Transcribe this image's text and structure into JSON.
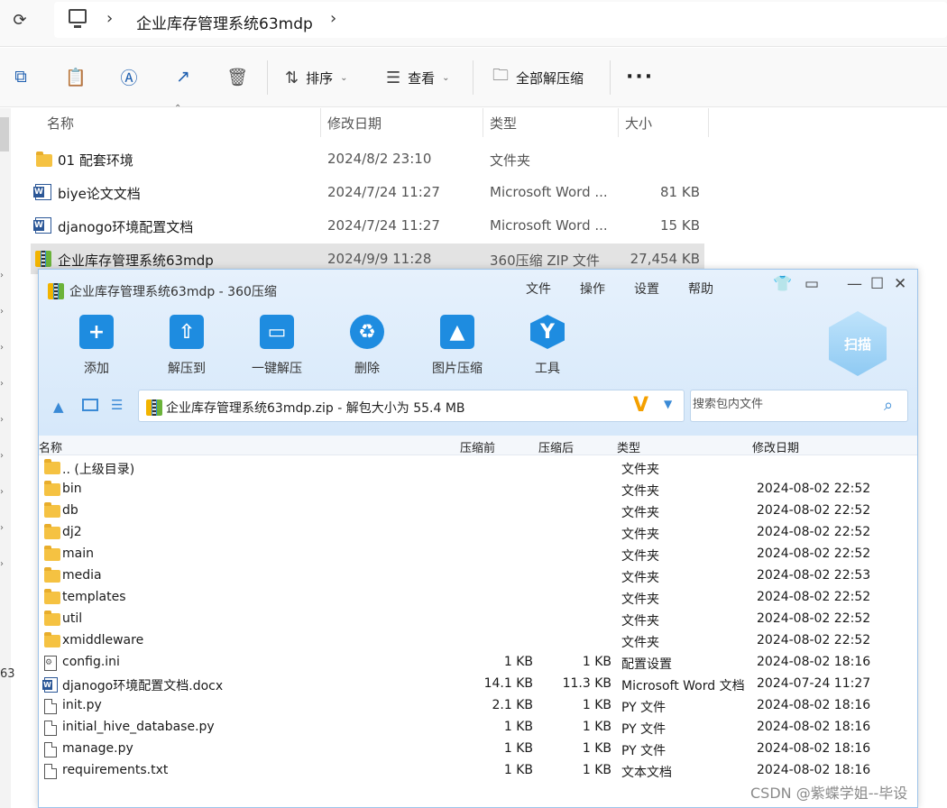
{
  "explorer": {
    "breadcrumb": {
      "current": "企业库存管理系统63mdp"
    },
    "toolbar": {
      "sort_label": "排序",
      "view_label": "查看",
      "extract_all_label": "全部解压缩"
    },
    "columns": {
      "name": "名称",
      "date": "修改日期",
      "type": "类型",
      "size": "大小"
    },
    "files": [
      {
        "name": "01 配套环境",
        "date": "2024/8/2 23:10",
        "type": "文件夹",
        "size": "",
        "icon": "folder-icon"
      },
      {
        "name": "biye论文文档",
        "date": "2024/7/24 11:27",
        "type": "Microsoft Word ...",
        "size": "81 KB",
        "icon": "word-icon"
      },
      {
        "name": "djanogo环境配置文档",
        "date": "2024/7/24 11:27",
        "type": "Microsoft Word ...",
        "size": "15 KB",
        "icon": "word-icon"
      },
      {
        "name": "企业库存管理系统63mdp",
        "date": "2024/9/9 11:28",
        "type": "360压缩 ZIP 文件",
        "size": "27,454 KB",
        "icon": "zip-icon",
        "selected": true
      }
    ],
    "nav_fragment": "63"
  },
  "zip": {
    "title": "企业库存管理系统63mdp - 360压缩",
    "menu": [
      "文件",
      "操作",
      "设置",
      "帮助"
    ],
    "tools": [
      {
        "label": "添加",
        "icon": "add-icon"
      },
      {
        "label": "解压到",
        "icon": "extract-to-icon"
      },
      {
        "label": "一键解压",
        "icon": "one-click-extract-icon"
      },
      {
        "label": "删除",
        "icon": "delete-icon"
      },
      {
        "label": "图片压缩",
        "icon": "image-compress-icon"
      },
      {
        "label": "工具",
        "icon": "tools-icon"
      }
    ],
    "scan_label": "扫描",
    "path": "企业库存管理系统63mdp.zip - 解包大小为 55.4 MB",
    "search_placeholder": "搜索包内文件",
    "columns": {
      "name": "名称",
      "before": "压缩前",
      "after": "压缩后",
      "type": "类型",
      "date": "修改日期"
    },
    "rows": [
      {
        "name": ".. (上级目录)",
        "before": "",
        "after": "",
        "type": "文件夹",
        "date": "",
        "icon": "folder-icon"
      },
      {
        "name": "bin",
        "before": "",
        "after": "",
        "type": "文件夹",
        "date": "2024-08-02 22:52",
        "icon": "folder-icon"
      },
      {
        "name": "db",
        "before": "",
        "after": "",
        "type": "文件夹",
        "date": "2024-08-02 22:52",
        "icon": "folder-icon"
      },
      {
        "name": "dj2",
        "before": "",
        "after": "",
        "type": "文件夹",
        "date": "2024-08-02 22:52",
        "icon": "folder-icon"
      },
      {
        "name": "main",
        "before": "",
        "after": "",
        "type": "文件夹",
        "date": "2024-08-02 22:52",
        "icon": "folder-icon"
      },
      {
        "name": "media",
        "before": "",
        "after": "",
        "type": "文件夹",
        "date": "2024-08-02 22:53",
        "icon": "folder-icon"
      },
      {
        "name": "templates",
        "before": "",
        "after": "",
        "type": "文件夹",
        "date": "2024-08-02 22:52",
        "icon": "folder-icon"
      },
      {
        "name": "util",
        "before": "",
        "after": "",
        "type": "文件夹",
        "date": "2024-08-02 22:52",
        "icon": "folder-icon"
      },
      {
        "name": "xmiddleware",
        "before": "",
        "after": "",
        "type": "文件夹",
        "date": "2024-08-02 22:52",
        "icon": "folder-icon"
      },
      {
        "name": "config.ini",
        "before": "1 KB",
        "after": "1 KB",
        "type": "配置设置",
        "date": "2024-08-02 18:16",
        "icon": "config-file-icon"
      },
      {
        "name": "djanogo环境配置文档.docx",
        "before": "14.1 KB",
        "after": "11.3 KB",
        "type": "Microsoft Word 文档",
        "date": "2024-07-24 11:27",
        "icon": "word-icon"
      },
      {
        "name": "init.py",
        "before": "2.1 KB",
        "after": "1 KB",
        "type": "PY 文件",
        "date": "2024-08-02 18:16",
        "icon": "file-icon"
      },
      {
        "name": "initial_hive_database.py",
        "before": "1 KB",
        "after": "1 KB",
        "type": "PY 文件",
        "date": "2024-08-02 18:16",
        "icon": "file-icon"
      },
      {
        "name": "manage.py",
        "before": "1 KB",
        "after": "1 KB",
        "type": "PY 文件",
        "date": "2024-08-02 18:16",
        "icon": "file-icon"
      },
      {
        "name": "requirements.txt",
        "before": "1 KB",
        "after": "1 KB",
        "type": "文本文档",
        "date": "2024-08-02 18:16",
        "icon": "text-file-icon"
      }
    ]
  },
  "watermark": "CSDN @紫蝶学姐--毕设"
}
